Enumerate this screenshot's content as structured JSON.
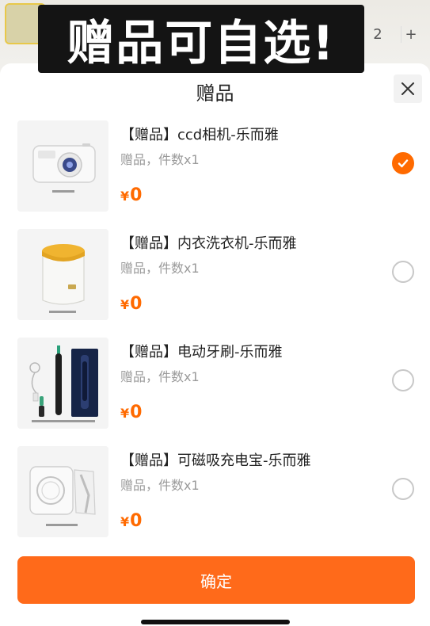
{
  "overlay_caption": "赠品可自选!",
  "background": {
    "qty_value": "2",
    "qty_plus": "+"
  },
  "sheet": {
    "title": "赠品",
    "confirm_label": "确定"
  },
  "gifts": [
    {
      "name": "【赠品】ccd相机-乐而雅",
      "subtitle": "赠品，件数x1",
      "currency": "¥",
      "price": "0",
      "selected": true,
      "icon": "camera-icon"
    },
    {
      "name": "【赠品】内衣洗衣机-乐而雅",
      "subtitle": "赠品，件数x1",
      "currency": "¥",
      "price": "0",
      "selected": false,
      "icon": "washer-icon"
    },
    {
      "name": "【赠品】电动牙刷-乐而雅",
      "subtitle": "赠品，件数x1",
      "currency": "¥",
      "price": "0",
      "selected": false,
      "icon": "toothbrush-icon"
    },
    {
      "name": "【赠品】可磁吸充电宝-乐而雅",
      "subtitle": "赠品，件数x1",
      "currency": "¥",
      "price": "0",
      "selected": false,
      "icon": "powerbank-icon"
    }
  ],
  "colors": {
    "accent": "#ff6a00",
    "button": "#ff6a1a"
  }
}
